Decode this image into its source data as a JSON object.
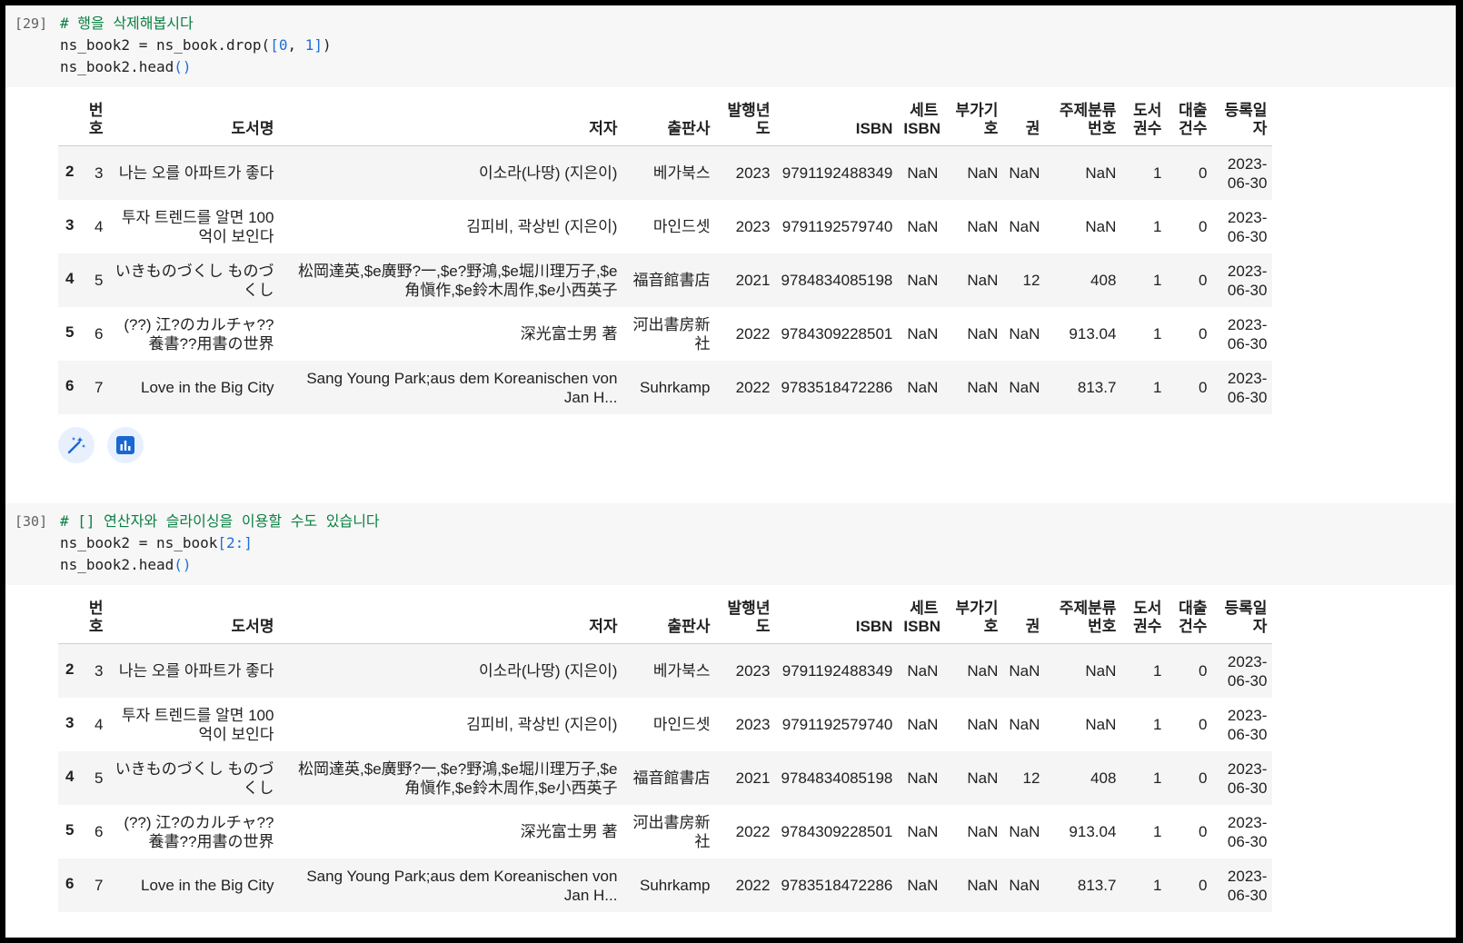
{
  "cells": [
    {
      "prompt": "[29]",
      "code": {
        "line1": "# 행을 삭제해봅시다",
        "line2_a": "ns_book2 = ns_book.drop(",
        "line2_b": "[",
        "line2_c": "0",
        "line2_d": ", ",
        "line2_e": "1",
        "line2_f": "]",
        "line2_g": ")",
        "line3_a": "ns_book2.head",
        "line3_b": "()"
      }
    },
    {
      "prompt": "[30]",
      "code": {
        "line1": "# [] 연산자와 슬라이싱을 이용할 수도 있습니다",
        "line2_a": "ns_book2 = ns_book",
        "line2_b": "[",
        "line2_c": "2:",
        "line2_d": "]",
        "line3_a": "ns_book2.head",
        "line3_b": "()"
      }
    }
  ],
  "table": {
    "headers": [
      "",
      "번호",
      "도서명",
      "저자",
      "출판사",
      "발행년도",
      "ISBN",
      "세트 ISBN",
      "부가기호",
      "권",
      "주제분류번호",
      "도서권수",
      "대출건수",
      "등록일자"
    ],
    "rows": [
      [
        "2",
        "3",
        "나는 오를 아파트가 좋다",
        "이소라(나땅) (지은이)",
        "베가북스",
        "2023",
        "9791192488349",
        "NaN",
        "NaN",
        "NaN",
        "NaN",
        "1",
        "0",
        "2023-06-30"
      ],
      [
        "3",
        "4",
        "투자 트렌드를 알면 100억이 보인다",
        "김피비, 곽상빈 (지은이)",
        "마인드셋",
        "2023",
        "9791192579740",
        "NaN",
        "NaN",
        "NaN",
        "NaN",
        "1",
        "0",
        "2023-06-30"
      ],
      [
        "4",
        "5",
        "いきものづくし ものづくし",
        "松岡達英,$e廣野?一,$e?野鴻,$e堀川理万子,$e角愼作,$e鈴木周作,$e小西英子",
        "福音館書店",
        "2021",
        "9784834085198",
        "NaN",
        "NaN",
        "12",
        "408",
        "1",
        "0",
        "2023-06-30"
      ],
      [
        "5",
        "6",
        "(??) 江?のカルチャ??養書??用書の世界",
        "深光富士男 著",
        "河出書房新社",
        "2022",
        "9784309228501",
        "NaN",
        "NaN",
        "NaN",
        "913.04",
        "1",
        "0",
        "2023-06-30"
      ],
      [
        "6",
        "7",
        "Love in the Big City",
        "Sang Young Park;aus dem Koreanischen von Jan H...",
        "Suhrkamp",
        "2022",
        "9783518472286",
        "NaN",
        "NaN",
        "NaN",
        "813.7",
        "1",
        "0",
        "2023-06-30"
      ]
    ]
  },
  "icons": [
    "magic-wand-icon",
    "bar-chart-icon"
  ],
  "colors": {
    "comment": "#0a8043",
    "number": "#1e6fd9",
    "accent": "#1967d2"
  }
}
